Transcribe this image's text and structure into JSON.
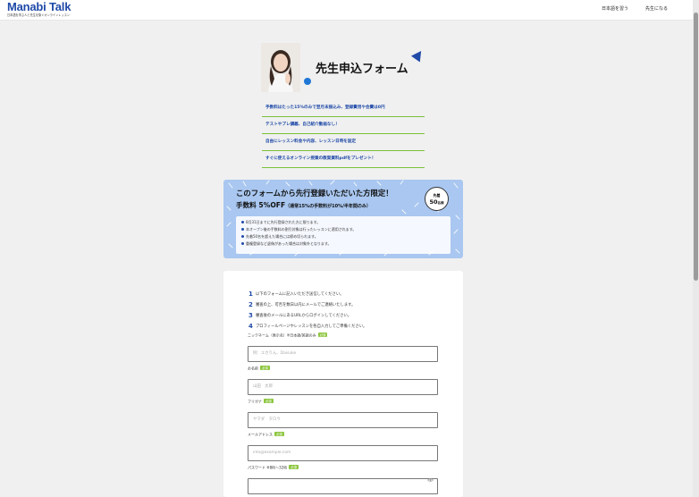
{
  "header": {
    "logo": "Manabi Talk",
    "tagline": "日本語を学ぶ人と先生を繋ぐオンラインレッスン",
    "nav": [
      "日本語を習う",
      "先生になる"
    ]
  },
  "hero": {
    "title": "先生申込フォーム",
    "benefits": [
      "手数料はたった15%のみで翌月末振込み、登録費用や会費は0円",
      "テストやプレ講義、自己紹介動画なし！",
      "自由にレッスン料金や内容、レッスン日時を設定",
      "すぐに使えるオンライン授業の教案資料pdfをプレゼント！"
    ]
  },
  "promo": {
    "title": "このフォームから先行登録いただいた方限定！",
    "discount": "手数料 5%OFF",
    "discount_note": "（通常15%の手数料が10%/半年間のみ）",
    "badge_top": "先着",
    "badge_number": "50",
    "badge_unit": "名様",
    "notes": [
      "8月31日までに先行登録された方に限ります。",
      "本オープン後の手数料の割引対象は行ったレッスンに適用されます。",
      "先着50名を超えた場合には締め切られます。",
      "重複登録など虚偽があった場合は対象外となります。"
    ],
    "colors": {
      "background": "#a9c7f0",
      "accent": "#1f4aa8"
    }
  },
  "form": {
    "steps": [
      {
        "num": "1",
        "text": "以下のフォームに記入いただき送信してください。"
      },
      {
        "num": "2",
        "text": "審査の上、可否を数日以内にメールでご連絡いたします。"
      },
      {
        "num": "3",
        "text": "審査後のメールにあるURLからログインしてください。"
      },
      {
        "num": "4",
        "text": "プロフィールページやレッスンを各自入力してご準備ください。"
      }
    ],
    "required_label": "必須",
    "fields": [
      {
        "label": "ニックネーム（表示名）※日本語/英語のみ",
        "placeholder": "例：ユカりん、Daisuke",
        "value": ""
      },
      {
        "label": "お名前",
        "placeholder": "山田　太郎",
        "value": ""
      },
      {
        "label": "フリガナ",
        "placeholder": "ヤマダ　タロウ",
        "value": ""
      },
      {
        "label": "メールアドレス",
        "placeholder": "info@example.com",
        "value": ""
      },
      {
        "label": "パスワード ※8桁〜32桁",
        "placeholder": "",
        "value": ""
      }
    ],
    "password_toggle_icon": "eye-icon"
  },
  "colors": {
    "brand": "#1f4aa8",
    "required": "#8dc63f",
    "divider": "#7ac23a"
  }
}
